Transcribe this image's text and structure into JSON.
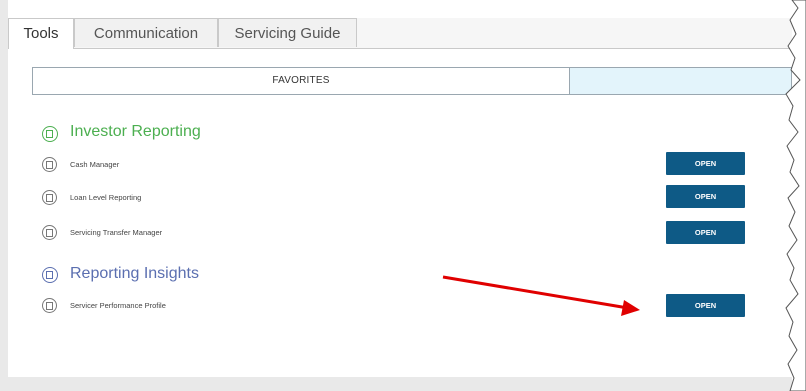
{
  "tabs": [
    {
      "label": "Tools",
      "active": true
    },
    {
      "label": "Communication",
      "active": false
    },
    {
      "label": "Servicing Guide",
      "active": false
    }
  ],
  "segmented": {
    "favorites_label": "FAVORITES",
    "other_label": ""
  },
  "sections": [
    {
      "title": "Investor Reporting",
      "title_color": "#4caf50",
      "icon": "document-icon",
      "items": [
        {
          "label": "Cash Manager",
          "button": "OPEN"
        },
        {
          "label": "Loan Level Reporting",
          "button": "OPEN"
        },
        {
          "label": "Servicing Transfer Manager",
          "button": "OPEN"
        }
      ]
    },
    {
      "title": "Reporting Insights",
      "title_color": "#5b6fb0",
      "icon": "document-icon",
      "items": [
        {
          "label": "Servicer Performance Profile",
          "button": "OPEN"
        }
      ]
    }
  ],
  "colors": {
    "button_bg": "#0e5a86",
    "annotation_arrow": "#e00000"
  }
}
